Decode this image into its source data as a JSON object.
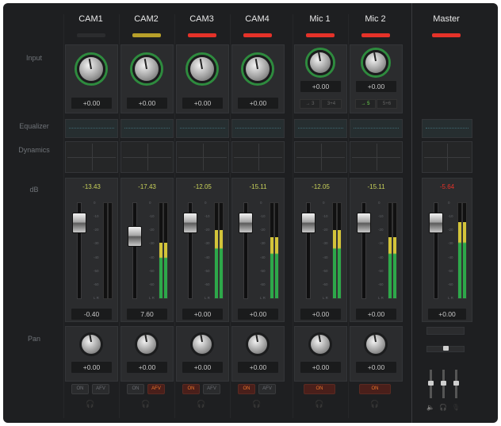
{
  "row_labels": {
    "input": "Input",
    "equalizer": "Equalizer",
    "dynamics": "Dynamics",
    "db": "dB",
    "pan": "Pan"
  },
  "colors": {
    "tally_red": "#e53229",
    "tally_yellow": "#b8a02a",
    "tally_off": "#2b2c2e",
    "meter_green": "#2da84a",
    "meter_yellow": "#d3c43a",
    "peak_yellow": "#c9d25a",
    "peak_red": "#e53229",
    "button_orange": "#e8742a"
  },
  "channels": [
    {
      "name": "CAM1",
      "tally": "off",
      "input_value": "+0.00",
      "peak": "-13.43",
      "fader_value": "-0.40",
      "fader_level": 0.86,
      "meter_level": 0.0,
      "pan_value": "+0.00",
      "btn1": "ON",
      "btn2": "AFV",
      "btn1_state": "off",
      "btn2_state": "off",
      "headphone": "headphone-icon"
    },
    {
      "name": "CAM2",
      "tally": "yellow",
      "input_value": "+0.00",
      "peak": "-17.43",
      "fader_value": "7.60",
      "fader_level": 0.72,
      "meter_level": 0.58,
      "pan_value": "+0.00",
      "btn1": "ON",
      "btn2": "AFV",
      "btn1_state": "off",
      "btn2_state": "red",
      "headphone": "headphone-icon"
    },
    {
      "name": "CAM3",
      "tally": "red",
      "input_value": "+0.00",
      "peak": "-12.05",
      "fader_value": "+0.00",
      "fader_level": 0.86,
      "meter_level": 0.72,
      "pan_value": "+0.00",
      "btn1": "ON",
      "btn2": "AFV",
      "btn1_state": "red",
      "btn2_state": "off",
      "headphone": "headphone-icon"
    },
    {
      "name": "CAM4",
      "tally": "red",
      "input_value": "+0.00",
      "peak": "-15.11",
      "fader_value": "+0.00",
      "fader_level": 0.86,
      "meter_level": 0.64,
      "pan_value": "+0.00",
      "btn1": "ON",
      "btn2": "AFV",
      "btn1_state": "red",
      "btn2_state": "off",
      "headphone": "headphone-icon"
    }
  ],
  "mics": [
    {
      "name": "Mic 1",
      "tally": "red",
      "input_value": "+0.00",
      "route_a": "→ 3",
      "route_b": "3+4",
      "route_active": false,
      "peak": "-12.05",
      "fader_value": "+0.00",
      "fader_level": 0.86,
      "meter_level": 0.72,
      "pan_value": "+0.00",
      "btn": "ON",
      "headphone": "headphone-icon"
    },
    {
      "name": "Mic 2",
      "tally": "red",
      "input_value": "+0.00",
      "route_a": "→ 5",
      "route_b": "5+6",
      "route_active": true,
      "peak": "-15.11",
      "fader_value": "+0.00",
      "fader_level": 0.86,
      "meter_level": 0.64,
      "pan_value": "+0.00",
      "btn": "ON",
      "headphone": "headphone-icon"
    }
  ],
  "master": {
    "name": "Master",
    "tally": "red",
    "peak": "-5.64",
    "fader_value": "+0.00",
    "fader_level": 0.86,
    "meter_level": 0.8,
    "icons": [
      "speaker-icon",
      "headphone-icon",
      "mic-icon"
    ]
  },
  "meter_ticks": [
    "0",
    "-10",
    "-20",
    "-30",
    "-40",
    "-50",
    "-60",
    "L R"
  ]
}
